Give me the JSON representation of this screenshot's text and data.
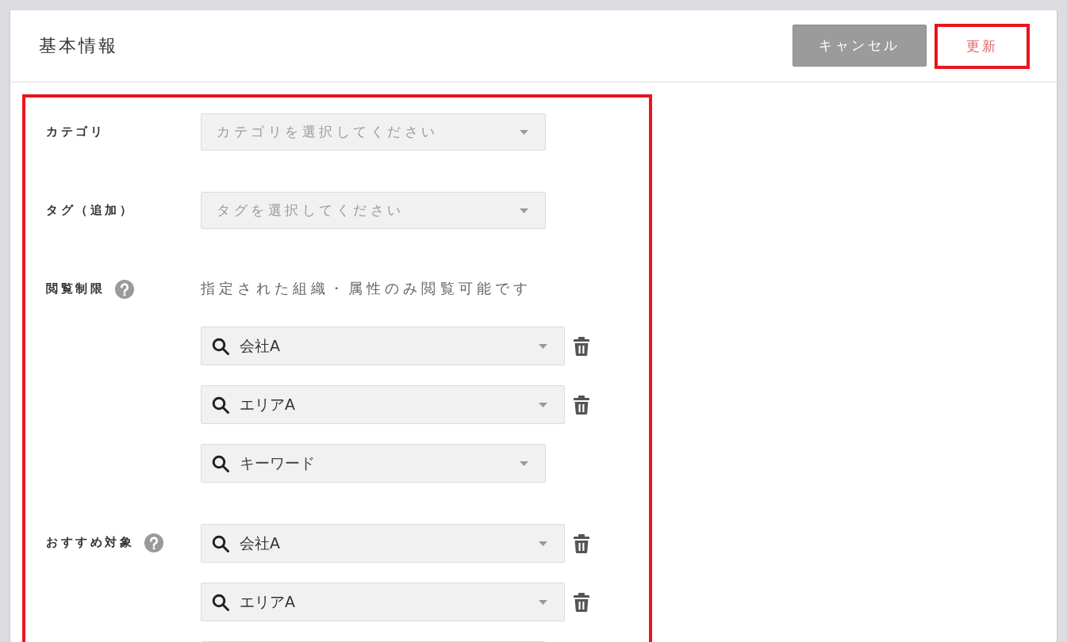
{
  "header": {
    "title": "基本情報",
    "buttons": [
      {
        "label": "キャンセル",
        "kind": "secondary",
        "highlighted": false
      },
      {
        "label": "更新",
        "kind": "primary",
        "highlighted": true
      }
    ]
  },
  "form": {
    "highlighted": true,
    "fields": [
      {
        "label": "カテゴリ",
        "kind": "select",
        "help": false,
        "placeholder": "カテゴリを選択してください"
      },
      {
        "label": "タグ（追加）",
        "kind": "select",
        "help": false,
        "placeholder": "タグを選択してください"
      },
      {
        "label": "閲覧制限",
        "kind": "search_list",
        "help": true,
        "description": "指定された組織・属性のみ閲覧可能です",
        "items": [
          {
            "value": "会社A",
            "removable": true
          },
          {
            "value": "エリアA",
            "removable": true
          },
          {
            "placeholder": "キーワード",
            "removable": false
          }
        ]
      },
      {
        "label": "おすすめ対象",
        "kind": "search_list",
        "help": true,
        "items": [
          {
            "value": "会社A",
            "removable": true
          },
          {
            "value": "エリアA",
            "removable": true
          },
          {
            "removable": false
          }
        ]
      }
    ]
  }
}
